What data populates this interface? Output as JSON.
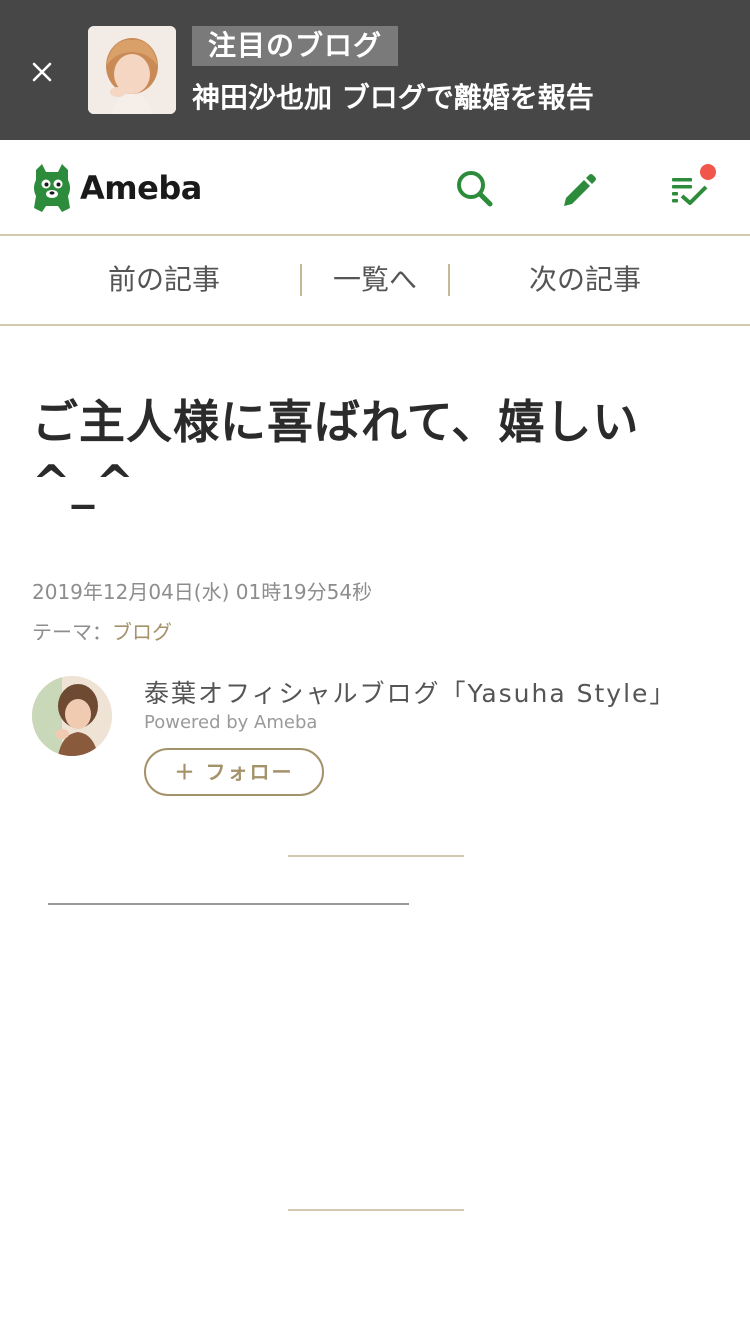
{
  "banner": {
    "tag": "注目のブログ",
    "headline": "神田沙也加 ブログで離婚を報告",
    "close_icon": "close-icon",
    "thumbnail": "banner-thumbnail"
  },
  "header": {
    "logo_text": "Ameba",
    "logo_icon": "ameba-mascot-icon",
    "search_icon": "search-icon",
    "edit_icon": "pencil-icon",
    "feed_icon": "checklist-icon",
    "accent_color": "#2d8c3c",
    "notification_color": "#f0574a"
  },
  "article_nav": {
    "prev": "前の記事",
    "list": "一覧へ",
    "next": "次の記事"
  },
  "article": {
    "title": "ご主人様に喜ばれて、嬉しい^_^",
    "date": "2019年12月04日(水) 01時19分54秒",
    "theme_label": "テーマ：",
    "theme_value": "ブログ"
  },
  "author": {
    "name": "泰葉オフィシャルブログ「Yasuha Style」",
    "powered_by": "Powered by Ameba",
    "follow_label": "＋ フォロー"
  },
  "colors": {
    "banner_bg": "#474747",
    "gold": "#a4926a",
    "rule": "#d2c9b0"
  }
}
